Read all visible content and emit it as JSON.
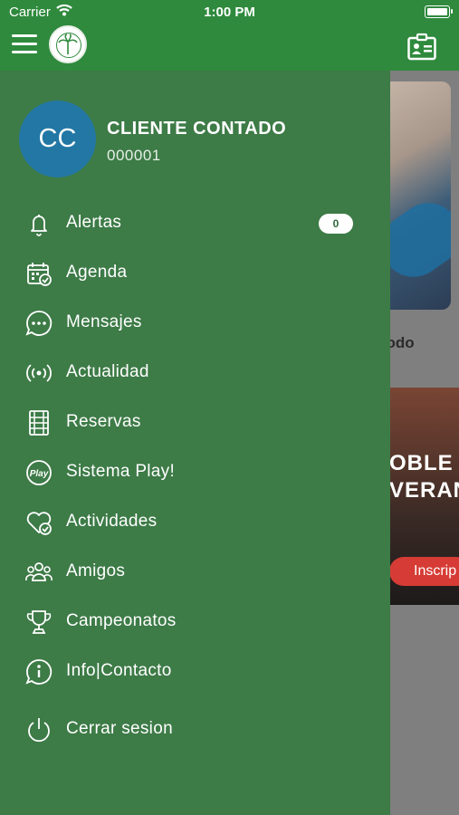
{
  "status_bar": {
    "carrier": "Carrier",
    "time": "1:00 PM"
  },
  "background": {
    "ver_todo": "er todo",
    "promo_line1": "OBLE",
    "promo_line2": "VERAN",
    "promo_button": "Inscrip"
  },
  "profile": {
    "initials": "CC",
    "name": "CLIENTE CONTADO",
    "code": "000001"
  },
  "menu": {
    "alertas": {
      "label": "Alertas",
      "badge": "0"
    },
    "agenda": "Agenda",
    "mensajes": "Mensajes",
    "actualidad": "Actualidad",
    "reservas": "Reservas",
    "sistema_play": "Sistema Play!",
    "actividades": "Actividades",
    "amigos": "Amigos",
    "campeonatos": "Campeonatos",
    "info_contacto": "Info|Contacto",
    "cerrar_sesion": "Cerrar sesion"
  },
  "icons": [
    "bell-icon",
    "calendar-check-icon",
    "chat-bubble-icon",
    "broadcast-icon",
    "court-icon",
    "play-badge-icon",
    "heart-check-icon",
    "group-icon",
    "trophy-icon",
    "info-icon",
    "power-icon",
    "menu-icon",
    "id-card-icon",
    "wifi-icon",
    "battery-icon"
  ],
  "colors": {
    "topbar": "#2f8a3d",
    "drawer": "#3d7b47",
    "avatar": "#2377a4",
    "accent_red": "#d63c35"
  }
}
